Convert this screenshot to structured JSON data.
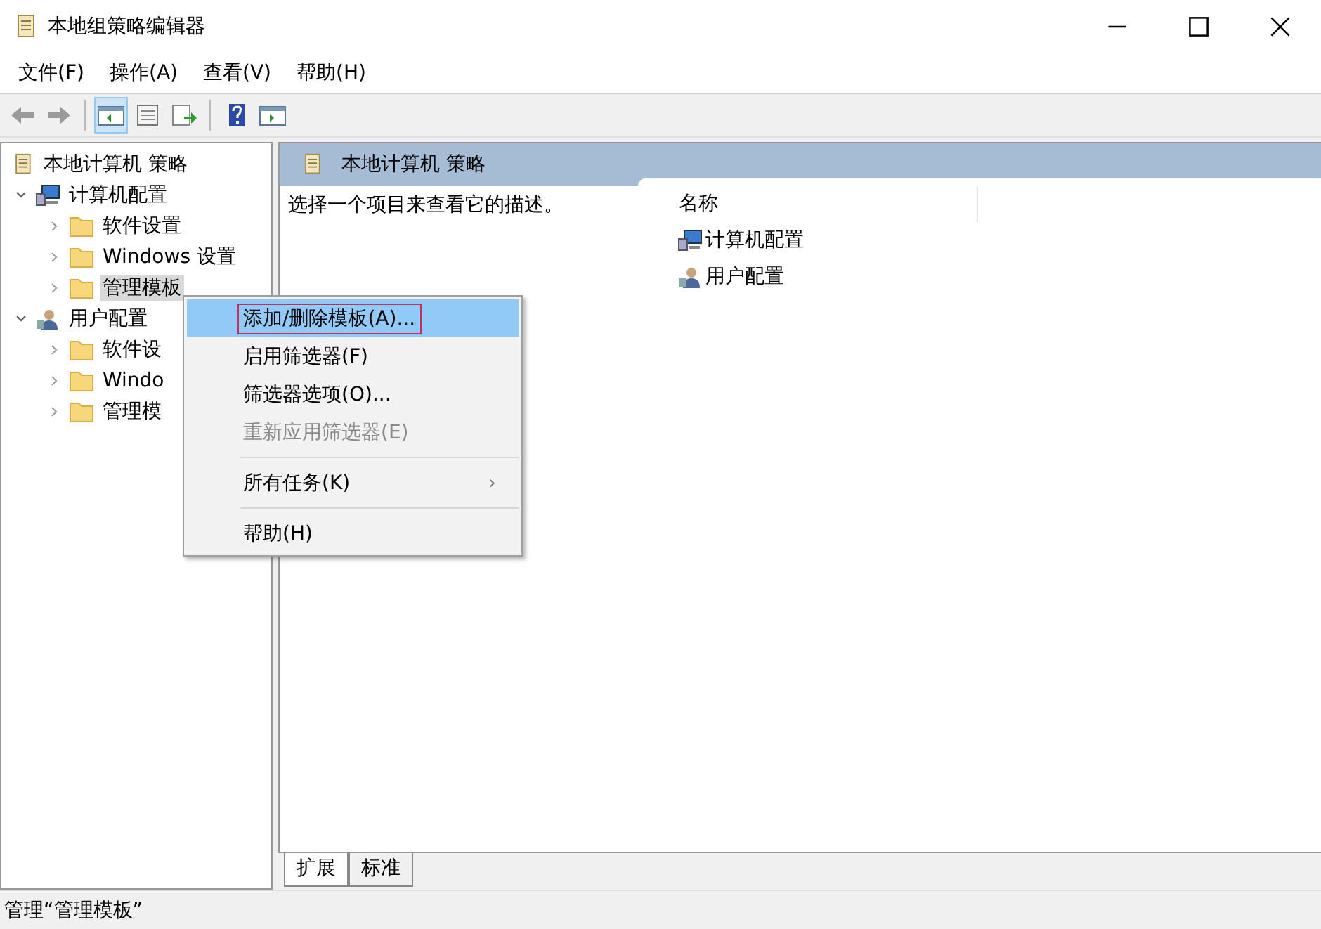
{
  "window": {
    "title": "本地组策略编辑器"
  },
  "menu_bar": [
    "文件(F)",
    "操作(A)",
    "查看(V)",
    "帮助(H)"
  ],
  "toolbar": [
    {
      "kind": "back",
      "pressed": false
    },
    {
      "kind": "forward",
      "pressed": false
    },
    {
      "kind": "separator"
    },
    {
      "kind": "tree",
      "pressed": true
    },
    {
      "kind": "properties",
      "pressed": false
    },
    {
      "kind": "export",
      "pressed": false
    },
    {
      "kind": "separator"
    },
    {
      "kind": "help",
      "pressed": false
    },
    {
      "kind": "view",
      "pressed": false
    }
  ],
  "tree": {
    "label": "本地计算机 策略",
    "children": [
      {
        "label": "计算机配置",
        "kind": "computer",
        "expanded": true,
        "selected": false,
        "children": [
          {
            "label": "软件设置",
            "kind": "folder",
            "expanded": false,
            "selected": false
          },
          {
            "label": "Windows 设置",
            "kind": "folder",
            "expanded": false,
            "selected": false
          },
          {
            "label": "管理模板",
            "kind": "folder",
            "expanded": false,
            "selected": true
          }
        ]
      },
      {
        "label": "用户配置",
        "kind": "user",
        "expanded": true,
        "selected": false,
        "children": [
          {
            "label": "软件设",
            "kind": "folder",
            "expanded": false,
            "selected": false
          },
          {
            "label": "Windo",
            "kind": "folder",
            "expanded": false,
            "selected": false
          },
          {
            "label": "管理模",
            "kind": "folder",
            "expanded": false,
            "selected": false
          }
        ]
      }
    ]
  },
  "context_menu": [
    {
      "kind": "item",
      "label": "添加/删除模板(A)...",
      "selected": true,
      "disabled": false
    },
    {
      "kind": "item",
      "label": "启用筛选器(F)",
      "selected": false,
      "disabled": false
    },
    {
      "kind": "item",
      "label": "筛选器选项(O)...",
      "selected": false,
      "disabled": false
    },
    {
      "kind": "item",
      "label": "重新应用筛选器(E)",
      "selected": false,
      "disabled": true
    },
    {
      "kind": "separator"
    },
    {
      "kind": "item",
      "label": "所有任务(K)",
      "selected": false,
      "disabled": false,
      "submenu": "›"
    },
    {
      "kind": "separator"
    },
    {
      "kind": "item",
      "label": "帮助(H)",
      "selected": false,
      "disabled": false
    }
  ],
  "details": {
    "title": "本地计算机 策略",
    "description": "选择一个项目来查看它的描述。",
    "column": "名称",
    "items": [
      {
        "label": "计算机配置",
        "kind": "computer"
      },
      {
        "label": "用户配置",
        "kind": "user"
      }
    ]
  },
  "tabs": [
    {
      "label": "扩展",
      "selected": true
    },
    {
      "label": "标准",
      "selected": false
    }
  ],
  "status_bar": "管理“管理模板”"
}
